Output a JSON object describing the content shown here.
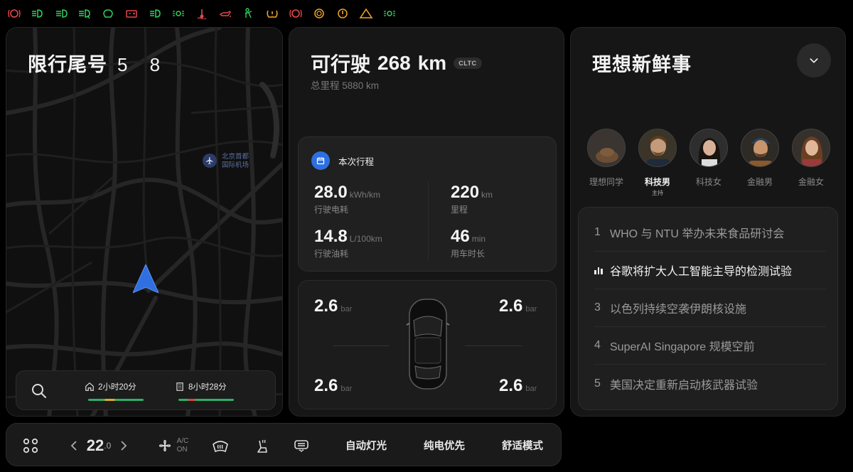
{
  "warning_icons": [
    {
      "name": "brake-warning-icon",
      "color": "#e5484d"
    },
    {
      "name": "low-beam-icon",
      "color": "#2fd15d"
    },
    {
      "name": "front-fog-icon",
      "color": "#2fd15d"
    },
    {
      "name": "auto-high-beam-icon",
      "color": "#2fd15d"
    },
    {
      "name": "steering-warning-icon",
      "color": "#2fd15d"
    },
    {
      "name": "battery-warning-icon",
      "color": "#e5484d"
    },
    {
      "name": "headlight-icon",
      "color": "#2fd15d"
    },
    {
      "name": "position-light-icon",
      "color": "#2fd15d"
    },
    {
      "name": "coolant-temp-icon",
      "color": "#e5484d"
    },
    {
      "name": "oil-pressure-icon",
      "color": "#e5484d"
    },
    {
      "name": "seatbelt-icon",
      "color": "#2fd15d"
    },
    {
      "name": "tyre-pressure-icon",
      "color": "#f5a623"
    },
    {
      "name": "brake-system-icon",
      "color": "#e5484d"
    },
    {
      "name": "traction-control-icon",
      "color": "#f5a623"
    },
    {
      "name": "abs-icon",
      "color": "#f5a623"
    },
    {
      "name": "general-warning-icon",
      "color": "#f5a623"
    },
    {
      "name": "parking-light-icon",
      "color": "#2fd15d"
    }
  ],
  "map": {
    "plate_label": "限行尾号",
    "plate_numbers": "5 8",
    "airport_label_line1": "北京首都",
    "airport_label_line2": "国际机场",
    "eta_home": "2小时20分",
    "eta_work": "8小时28分",
    "colors": {
      "traffic_green": "#2fae6a",
      "traffic_yellow": "#e0a82a",
      "traffic_red": "#d9463e",
      "nav_blue": "#2f6fe0"
    }
  },
  "range": {
    "label": "可行驶",
    "value": "268",
    "unit": "km",
    "standard": "CLTC",
    "odometer": "总里程 5880 km"
  },
  "trip": {
    "title": "本次行程",
    "stats": [
      {
        "value": "28.0",
        "unit": "kWh/km",
        "label": "行驶电耗"
      },
      {
        "value": "220",
        "unit": "km",
        "label": "里程"
      },
      {
        "value": "14.8",
        "unit": "L/100km",
        "label": "行驶油耗"
      },
      {
        "value": "46",
        "unit": "min",
        "label": "用车时长"
      }
    ]
  },
  "tyres": {
    "unit": "bar",
    "front_left": "2.6",
    "front_right": "2.6",
    "rear_left": "2.6",
    "rear_right": "2.6"
  },
  "news": {
    "title": "理想新鲜事",
    "hosts": [
      {
        "name": "理想同学",
        "sub": ""
      },
      {
        "name": "科技男",
        "sub": "主持"
      },
      {
        "name": "科技女",
        "sub": ""
      },
      {
        "name": "金融男",
        "sub": ""
      },
      {
        "name": "金融女",
        "sub": ""
      }
    ],
    "items": [
      {
        "index": "1",
        "text": "WHO 与 NTU 举办未来食品研讨会"
      },
      {
        "index": "",
        "text": "谷歌将扩大人工智能主导的检测试验"
      },
      {
        "index": "3",
        "text": "以色列持续空袭伊朗核设施"
      },
      {
        "index": "4",
        "text": "SuperAI Singapore 规模空前"
      },
      {
        "index": "5",
        "text": "美国决定重新启动核武器试验"
      }
    ]
  },
  "dock": {
    "temp_main": "22",
    "temp_dec": ".0",
    "ac_label": "A/C",
    "ac_state": "ON",
    "auto_light": "自动灯光",
    "ev_priority": "纯电优先",
    "comfort_mode": "舒适模式"
  }
}
